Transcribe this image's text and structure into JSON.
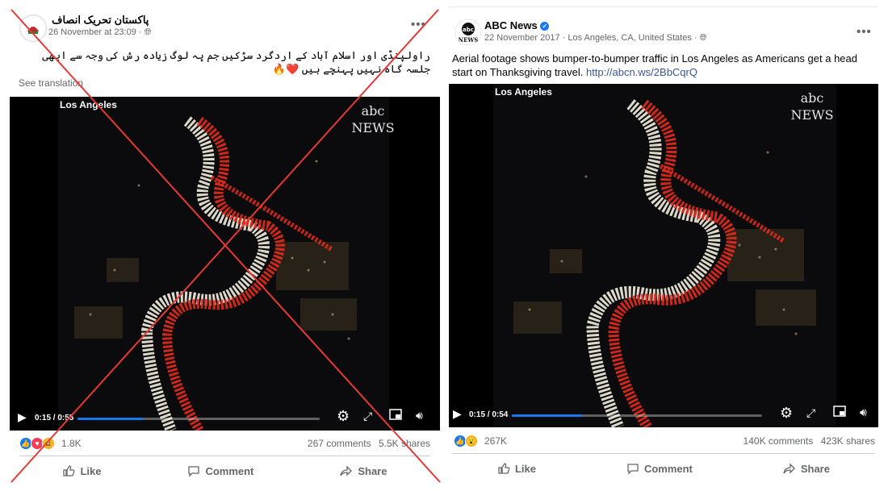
{
  "left_post": {
    "page_name": "پاکستان تحریک انصاف",
    "date": "26 November at 23:09 ·",
    "text": "راولپنڈی اور اسلام آباد کے اردگرد سڑکیں جم پہ لوگ زیادہ رش کی وجہ سے ابھی جلسہ گاہ نہیں پہنچے ہیں ❤️🔥",
    "see_translation": "See translation",
    "video": {
      "caption": "Los Angeles",
      "logo_abc": "abc",
      "logo_news": "NEWS",
      "time": "0:15 / 0:55",
      "progress": 0.27
    },
    "reactions_count": "1.8K",
    "comments": "267 comments",
    "shares": "5.5K shares"
  },
  "right_post": {
    "page_name": "ABC News",
    "date": "22 November 2017 · Los Angeles, CA, United States ·",
    "text": "Aerial footage shows bumper-to-bumper traffic in Los Angeles as Americans get a head start on Thanksgiving travel.",
    "link": "http://abcn.ws/2BbCqrQ",
    "video": {
      "caption": "Los Angeles",
      "logo_abc": "abc",
      "logo_news": "NEWS",
      "time": "0:15 / 0:54",
      "progress": 0.28
    },
    "reactions_count": "267K",
    "comments": "140K comments",
    "shares": "423K shares"
  },
  "actions": {
    "like": "Like",
    "comment": "Comment",
    "share": "Share"
  },
  "colors": {
    "cross": "#e53935",
    "link": "#385898",
    "progress": "#1877f2"
  }
}
